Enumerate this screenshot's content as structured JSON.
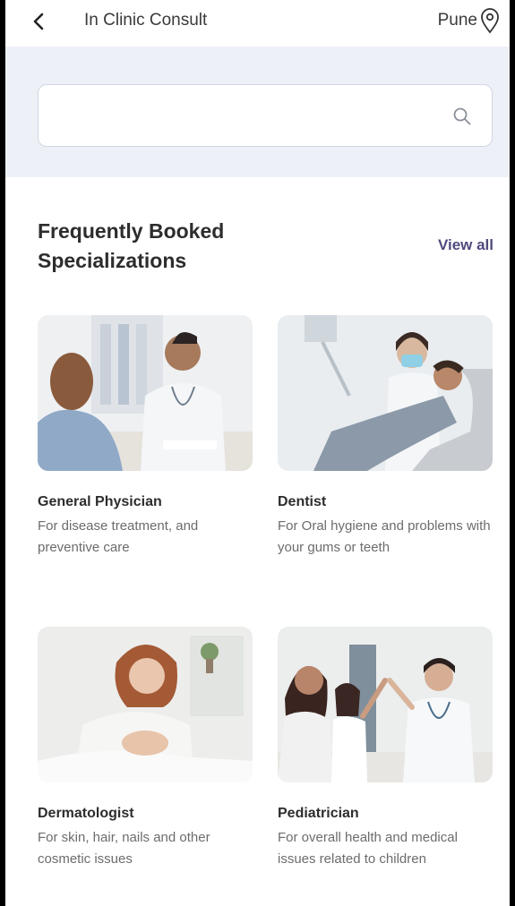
{
  "header": {
    "title": "In Clinic Consult",
    "city": "Pune",
    "back_icon": "chevron-left-icon",
    "location_icon": "map-pin-icon"
  },
  "search": {
    "placeholder": "",
    "value": "",
    "icon": "search-icon"
  },
  "section": {
    "title": "Frequently Booked Specializations",
    "view_all": "View all"
  },
  "specializations": [
    {
      "name": "General Physician",
      "description": "For disease treatment, and preventive care"
    },
    {
      "name": "Dentist",
      "description": "For Oral hygiene and problems with your gums or teeth"
    },
    {
      "name": "Dermatologist",
      "description": "For skin, hair, nails and other cosmetic issues"
    },
    {
      "name": "Pediatrician",
      "description": "For overall health and medical issues related to children"
    }
  ],
  "colors": {
    "accent": "#4e4a7d",
    "band": "#edf1f7",
    "text_dark": "#2d2d2d",
    "text_muted": "#6c6c6c"
  }
}
